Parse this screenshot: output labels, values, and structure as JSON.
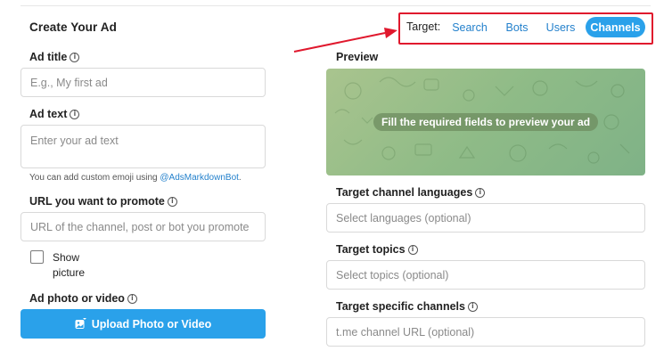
{
  "form": {
    "heading": "Create Your Ad",
    "ad_title": {
      "label": "Ad title",
      "placeholder": "E.g., My first ad"
    },
    "ad_text": {
      "label": "Ad text",
      "placeholder": "Enter your ad text"
    },
    "hint": {
      "text": "You can add custom emoji using ",
      "link": "@AdsMarkdownBot",
      "suffix": "."
    },
    "url": {
      "label": "URL you want to promote",
      "placeholder": "URL of the channel, post or bot you promote"
    },
    "show_picture": {
      "line1": "Show",
      "line2": "picture",
      "checked": false
    },
    "photo": {
      "label": "Ad photo or video",
      "button": "Upload Photo or Video"
    }
  },
  "target": {
    "label": "Target:",
    "tabs": [
      {
        "label": "Search",
        "active": false
      },
      {
        "label": "Bots",
        "active": false
      },
      {
        "label": "Users",
        "active": false
      },
      {
        "label": "Channels",
        "active": true
      }
    ]
  },
  "preview": {
    "label": "Preview",
    "message": "Fill the required fields to preview your ad"
  },
  "targeting": {
    "languages": {
      "label": "Target channel languages",
      "placeholder": "Select languages (optional)"
    },
    "topics": {
      "label": "Target topics",
      "placeholder": "Select topics (optional)"
    },
    "channels": {
      "label": "Target specific channels",
      "placeholder": "t.me channel URL (optional)"
    }
  },
  "colors": {
    "accent": "#2aa1ea",
    "link": "#2481cc",
    "highlight_border": "#e0182d"
  },
  "icons": [
    "info-icon",
    "upload-photo-icon",
    "arrow-annotation"
  ]
}
